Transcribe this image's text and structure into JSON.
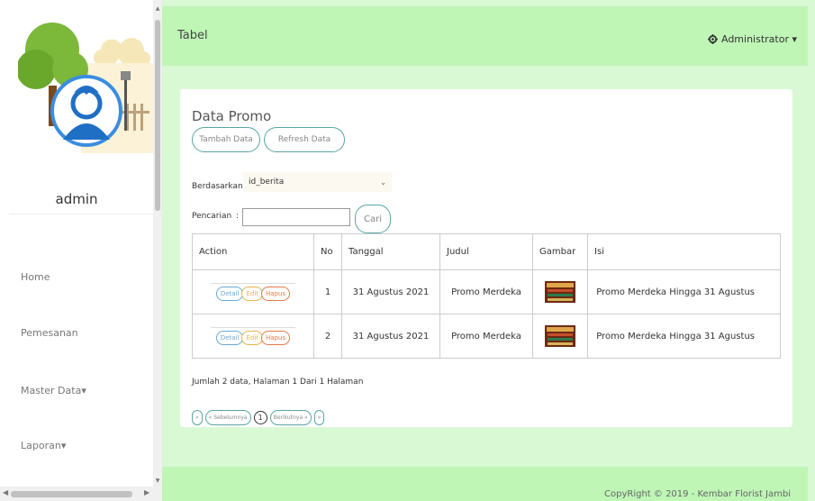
{
  "sidebar": {
    "admin_name": "admin",
    "nav": [
      {
        "label": "Home"
      },
      {
        "label": "Pemesanan"
      },
      {
        "label": "Master Data▾"
      },
      {
        "label": "Laporan▾"
      }
    ]
  },
  "header": {
    "page_title": "Tabel",
    "user_menu": "Administrator ▾",
    "user_icon": "gear-icon"
  },
  "card": {
    "title": "Data Promo",
    "buttons": {
      "add": "Tambah Data",
      "refresh": "Refresh Data"
    },
    "filter": {
      "by_label": "Berdasarkan:",
      "by_value": "id_berita",
      "search_label": "Pencarian",
      "search_value": "",
      "search_button": "Cari"
    },
    "table": {
      "columns": [
        "Action",
        "No",
        "Tanggal",
        "Judul",
        "Gambar",
        "Isi"
      ],
      "rows": [
        {
          "no": "1",
          "tanggal": "31 Agustus 2021",
          "judul": "Promo Merdeka",
          "isi": "Promo Merdeka Hingga 31 Agustus"
        },
        {
          "no": "2",
          "tanggal": "31 Agustus 2021",
          "judul": "Promo Merdeka",
          "isi": "Promo Merdeka Hingga 31 Agustus"
        }
      ],
      "actions": {
        "detail": "Detail",
        "edit": "Edit",
        "hapus": "Hapus"
      }
    },
    "summary": "Jumlah 2 data, Halaman 1 Dari 1 Halaman",
    "pager": {
      "first": "«",
      "prev": "« Sebelumnya",
      "current": "1",
      "next": "Berikutnya »",
      "last": "»"
    }
  },
  "footer": {
    "text": "CopyRight © 2019 - Kembar Florist Jambi"
  },
  "colors": {
    "main_bg": "#d9f8d4",
    "topbar_bg": "#bff6b6",
    "accent_border": "#5aa6a3"
  }
}
